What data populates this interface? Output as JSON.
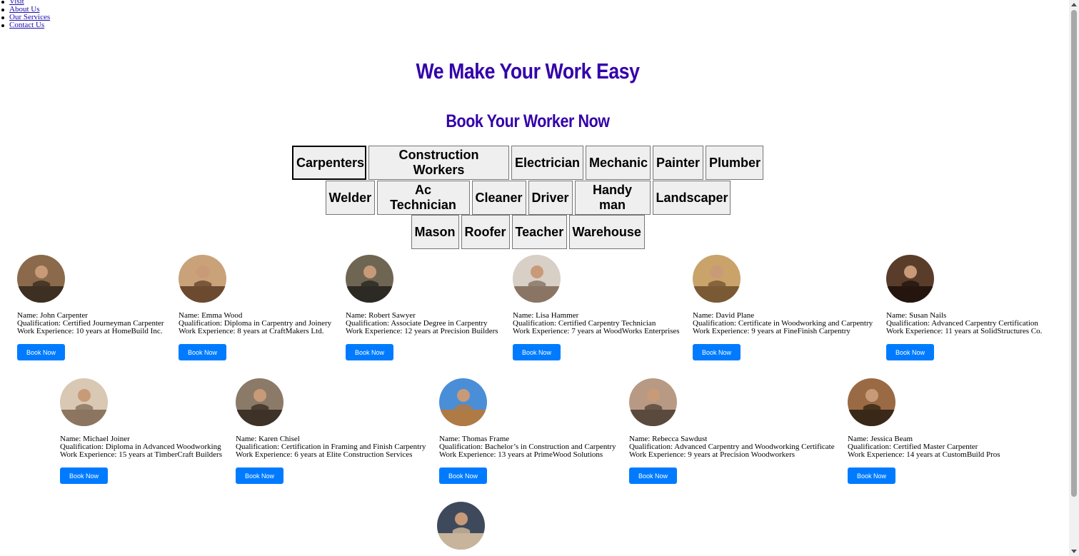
{
  "nav": [
    "Visit",
    "About Us",
    "Our Services",
    "Contact Us"
  ],
  "hero_title": "We Make Your Work Easy",
  "section_title": "Book Your Worker Now",
  "categories": [
    [
      "Carpenters",
      "Construction Workers",
      "Electrician",
      "Mechanic",
      "Painter",
      "Plumber"
    ],
    [
      "Welder",
      "Ac Technician",
      "Cleaner",
      "Driver",
      "Handy man",
      "Landscaper"
    ],
    [
      "Mason",
      "Roofer",
      "Teacher",
      "Warehouse"
    ]
  ],
  "active_category": "Carpenters",
  "book_label": "Book Now",
  "workers": [
    {
      "name": "Name: John Carpenter",
      "qual": "Qualification: Certified Journeyman Carpenter",
      "exp": "Work Experience: 10 years at HomeBuild Inc."
    },
    {
      "name": "Name: Emma Wood",
      "qual": "Qualification: Diploma in Carpentry and Joinery",
      "exp": "Work Experience: 8 years at CraftMakers Ltd."
    },
    {
      "name": "Name: Robert Sawyer",
      "qual": "Qualification: Associate Degree in Carpentry",
      "exp": "Work Experience: 12 years at Precision Builders"
    },
    {
      "name": "Name: Lisa Hammer",
      "qual": "Qualification: Certified Carpentry Technician",
      "exp": "Work Experience: 7 years at WoodWorks Enterprises"
    },
    {
      "name": "Name: David Plane",
      "qual": "Qualification: Certificate in Woodworking and Carpentry",
      "exp": "Work Experience: 9 years at FineFinish Carpentry"
    },
    {
      "name": "Name: Susan Nails",
      "qual": "Qualification: Advanced Carpentry Certification",
      "exp": "Work Experience: 11 years at SolidStructures Co."
    },
    {
      "name": "Name: Michael Joiner",
      "qual": "Qualification: Diploma in Advanced Woodworking",
      "exp": "Work Experience: 15 years at TimberCraft Builders"
    },
    {
      "name": "Name: Karen Chisel",
      "qual": "Qualification: Certification in Framing and Finish Carpentry",
      "exp": "Work Experience: 6 years at Elite Construction Services"
    },
    {
      "name": "Name: Thomas Frame",
      "qual": "Qualification: Bachelor’s in Construction and Carpentry",
      "exp": "Work Experience: 13 years at PrimeWood Solutions"
    },
    {
      "name": "Name: Rebecca Sawdust",
      "qual": "Qualification: Advanced Carpentry and Woodworking Certificate",
      "exp": "Work Experience: 9 years at Precision Woodworkers"
    },
    {
      "name": "Name: Jessica Beam",
      "qual": "Qualification: Certified Master Carpenter",
      "exp": "Work Experience: 14 years at CustomBuild Pros"
    },
    {
      "name": "",
      "qual": "",
      "exp": ""
    }
  ],
  "avatar_colors": [
    [
      "#8a6a4a",
      "#3d2f22"
    ],
    [
      "#c9a27a",
      "#6b4a30"
    ],
    [
      "#6f6553",
      "#2d2a24"
    ],
    [
      "#d8cfc6",
      "#8a7565"
    ],
    [
      "#c9a36a",
      "#7a5a35"
    ],
    [
      "#5a3c2a",
      "#24160f"
    ],
    [
      "#d8c8b4",
      "#8c7660"
    ],
    [
      "#8b7a68",
      "#3e3328"
    ],
    [
      "#4a8ed8",
      "#b07a45"
    ],
    [
      "#b89a84",
      "#5a4a3e"
    ],
    [
      "#9a6a44",
      "#3a2818"
    ],
    [
      "#3e4a5c",
      "#c8b49a"
    ]
  ]
}
